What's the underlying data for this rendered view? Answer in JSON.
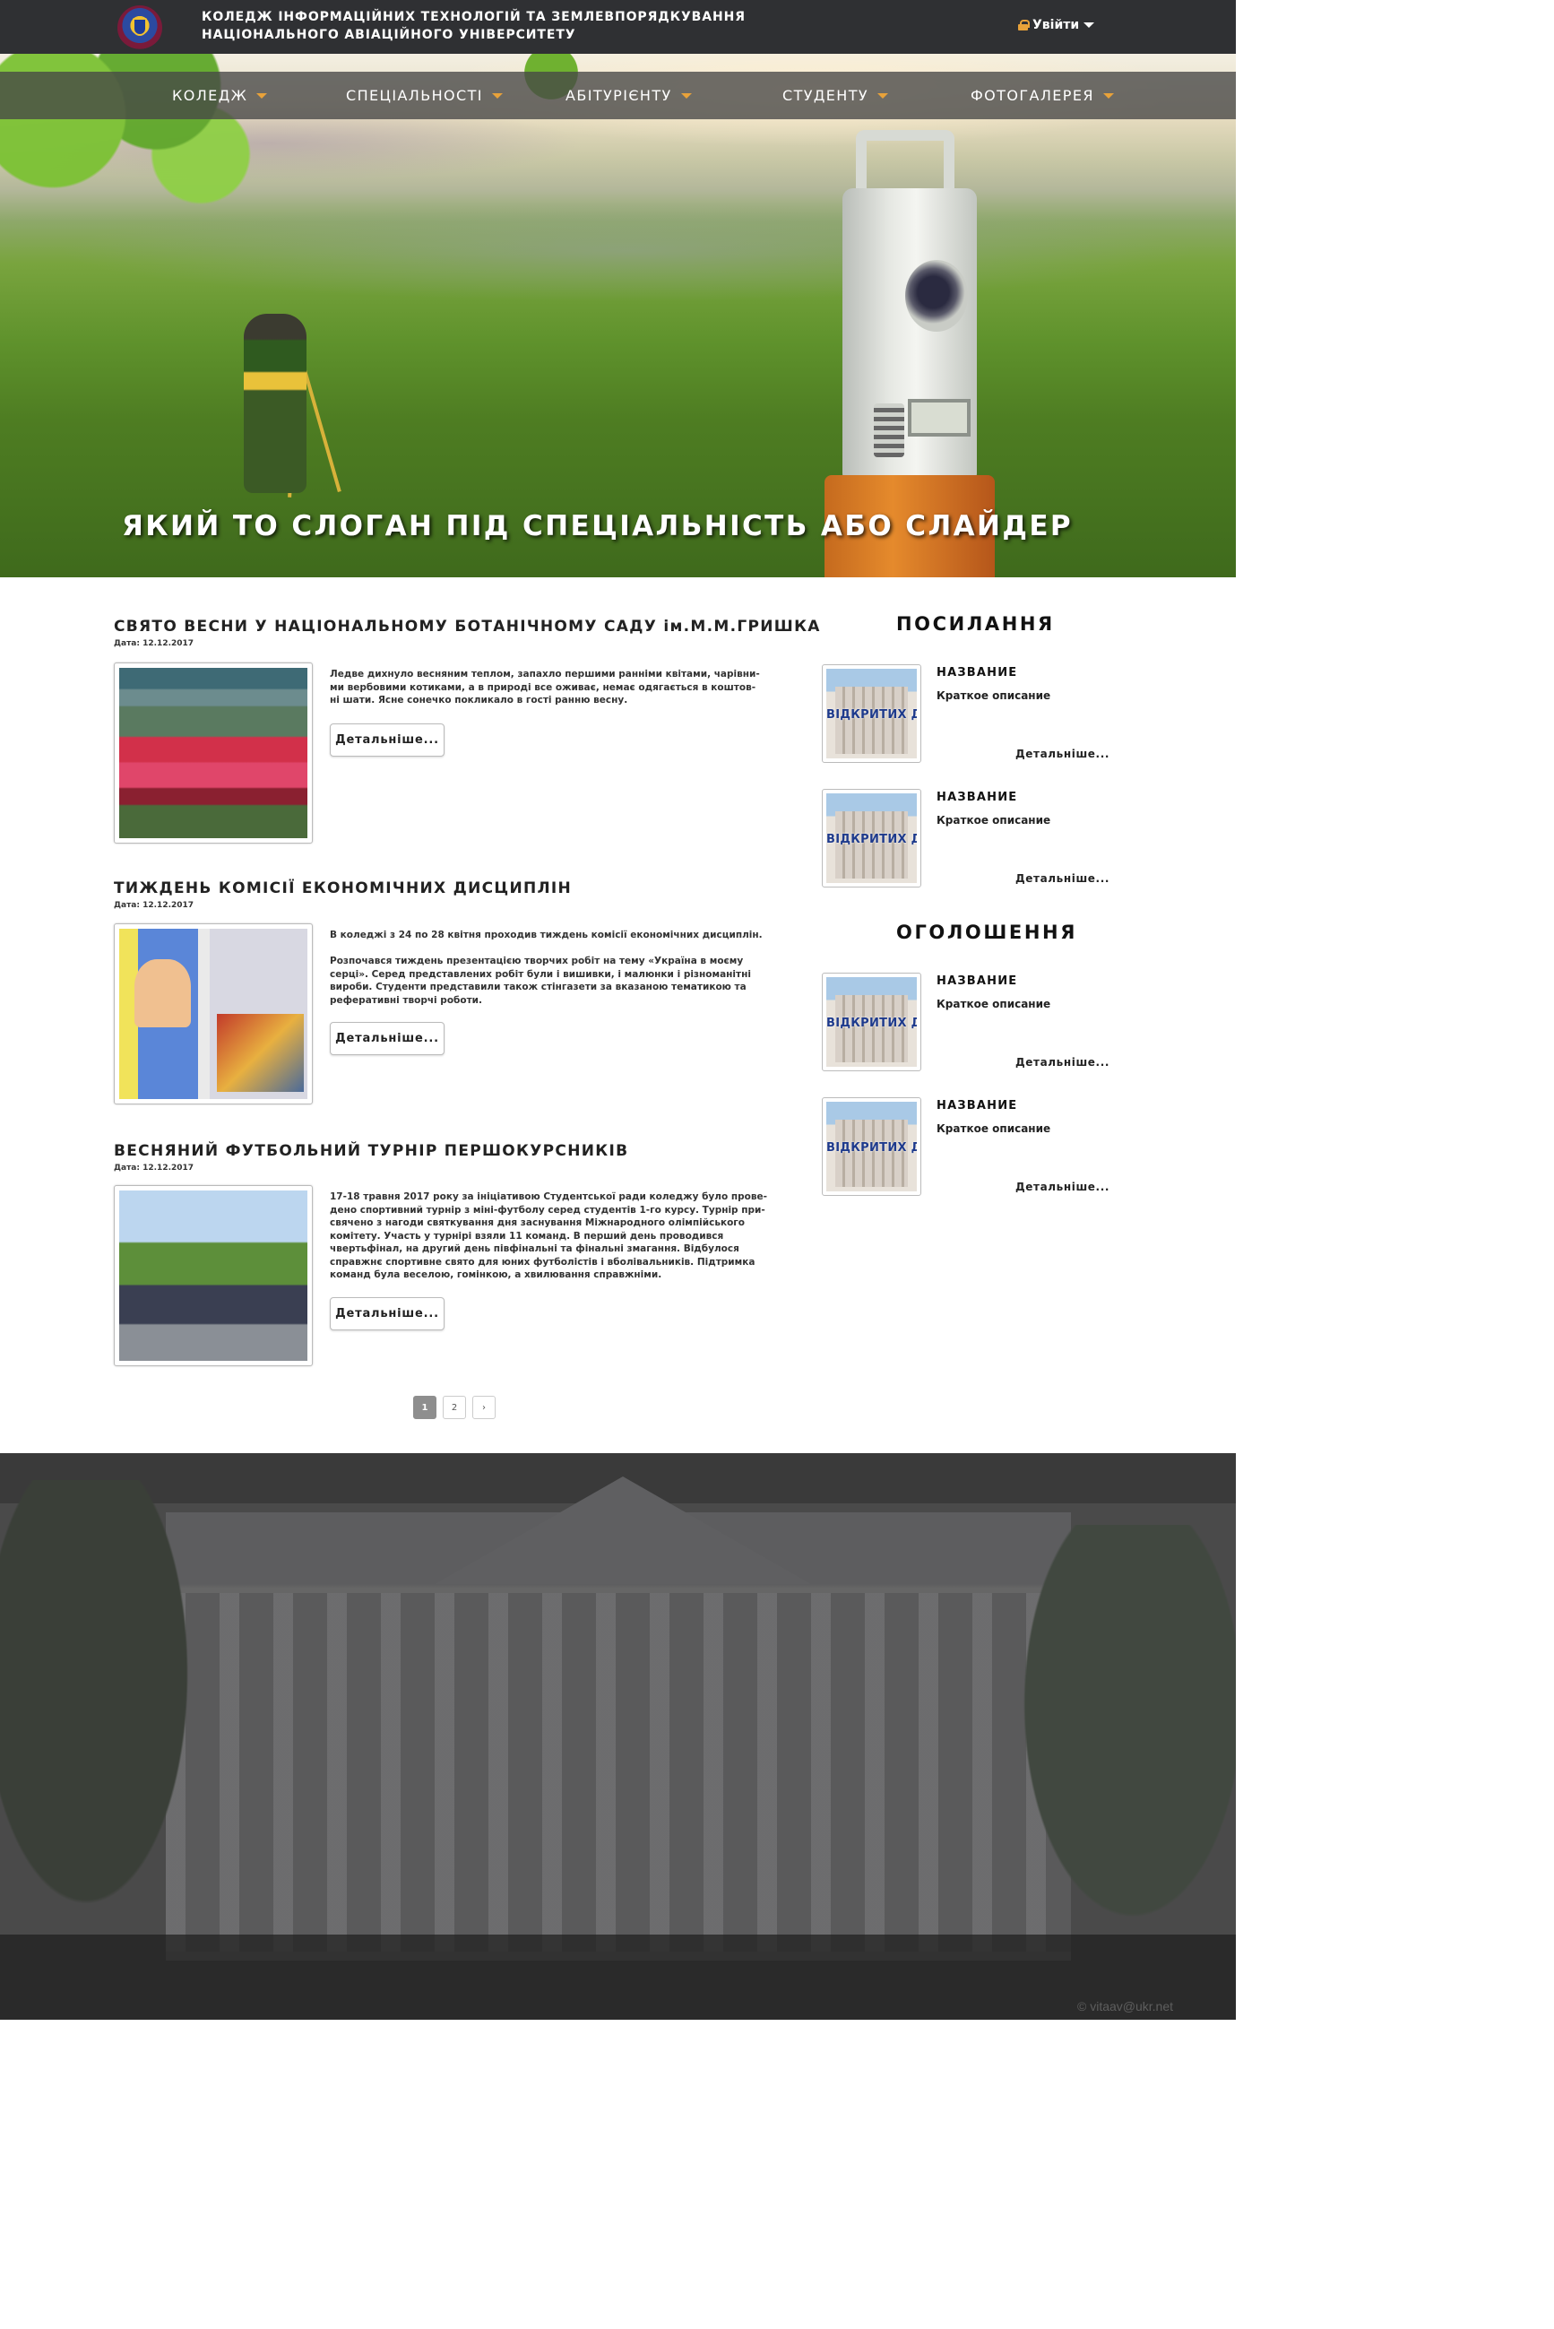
{
  "header": {
    "college_name_line1": "КОЛЕДЖ ІНФОРМАЦІЙНИХ ТЕХНОЛОГІЙ ТА ЗЕМЛЕВПОРЯДКУВАННЯ",
    "college_name_line2": "НАЦІОНАЛЬНОГО АВІАЦІЙНОГО УНІВЕРСИТЕТУ",
    "login_label": "Увійти"
  },
  "nav": {
    "items": [
      {
        "label": "КОЛЕДЖ"
      },
      {
        "label": "СПЕЦІАЛЬНОСТІ"
      },
      {
        "label": "АБІТУРІЄНТУ"
      },
      {
        "label": "СТУДЕНТУ"
      },
      {
        "label": "ФОТОГАЛЕРЕЯ"
      }
    ]
  },
  "hero": {
    "slogan": "ЯКИЙ ТО СЛОГАН ПІД СПЕЦІАЛЬНІСТЬ АБО СЛАЙДЕР"
  },
  "news": [
    {
      "title": "СВЯТО ВЕСНИ У НАЦІОНАЛЬНОМУ БОТАНІЧНОМУ САДУ ім.М.М.ГРИШКА",
      "date": "Дата: 12.12.2017",
      "text": "Ледве дихнуло весняним теплом, запахло першими ранніми квітами, чарівни-\nми вербовими котиками, а в природі все оживає, немає одягається в коштов-\nні шати. Ясне сонечко покликало в гості ранню весну.",
      "more": "Детальніше..."
    },
    {
      "title": "ТИЖДЕНЬ КОМІСІЇ ЕКОНОМІЧНИХ ДИСЦИПЛІН",
      "date": "Дата: 12.12.2017",
      "text": "В коледжі з 24 по 28 квітня проходив тиждень комісії економічних дисциплін.\n\nРозпочався тиждень презентацією творчих робіт на тему «Україна в моєму\nсерці». Серед представлених робіт були і вишивки, і малюнки і різноманітні\nвироби. Студенти представили також стінгазети за вказаною тематикою та\nреферативні творчі роботи.",
      "more": "Детальніше..."
    },
    {
      "title": "ВЕСНЯНИЙ ФУТБОЛЬНИЙ ТУРНІР ПЕРШОКУРСНИКІВ",
      "date": "Дата: 12.12.2017",
      "text": "17-18 травня 2017 року за ініціативою Студентської ради коледжу було прове-\nдено спортивний турнір з міні-футболу серед студентів 1-го курсу. Турнір при-\nсвячено з нагоди святкування дня заснування Міжнародного олімпійського\nкомітету. Участь у турнірі взяли 11 команд. В перший день проводився\nчвертьфінал, на другий день півфінальні та фінальні змагання. Відбулося\nсправжнє спортивне свято для юних футболістів і вболівальників. Підтримка\nкоманд була веселою, гомінкою, а хвилювання справжніми.",
      "more": "Детальніше..."
    }
  ],
  "pagination": {
    "pages": [
      "1",
      "2"
    ],
    "next": "›"
  },
  "sidebar": {
    "links_heading": "ПОСИЛАННЯ",
    "announcements_heading": "ОГОЛОШЕННЯ",
    "thumb_text": "ВІДКРИТИХ ДВЕ",
    "links": [
      {
        "name": "НАЗВАНИЕ",
        "desc": "Краткое описание",
        "more": "Детальніше..."
      },
      {
        "name": "НАЗВАНИЕ",
        "desc": "Краткое описание",
        "more": "Детальніше..."
      }
    ],
    "announcements": [
      {
        "name": "НАЗВАНИЕ",
        "desc": "Краткое описание",
        "more": "Детальніше..."
      },
      {
        "name": "НАЗВАНИЕ",
        "desc": "Краткое описание",
        "more": "Детальніше..."
      }
    ]
  },
  "footer": {
    "watermark": "© vitaav@ukr.net"
  }
}
